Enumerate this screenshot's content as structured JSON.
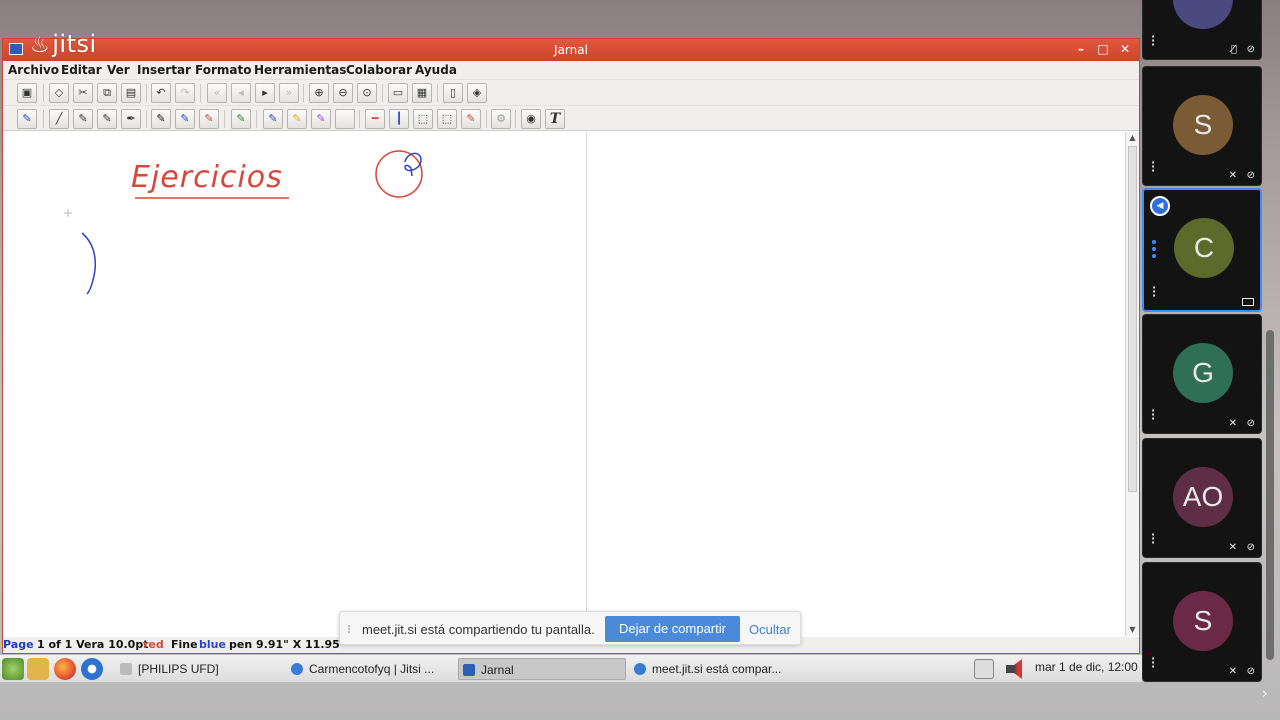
{
  "window": {
    "title": "Jarnal",
    "minimize_label": "–",
    "maximize_label": "□",
    "close_label": "✕"
  },
  "overlay_logo": {
    "text": "jitsi",
    "mark": "♨"
  },
  "menu": [
    "Archivo",
    "Editar",
    "Ver",
    "Insertar",
    "Formato",
    "Herramientas",
    "Colaborar",
    "Ayuda"
  ],
  "canvas": {
    "handwritten_title": "Ejercicios"
  },
  "status": {
    "page_prefix": "Page",
    "page_rest": "1 of 1 Vera 10.0pt",
    "color1": "red",
    "pen_word": "Fine",
    "color2": "blue",
    "size_text": "pen  9.91\" X 11.95\""
  },
  "share": {
    "message": "meet.jit.si está compartiendo tu pantalla.",
    "stop_button": "Dejar de compartir",
    "hide_link": "Ocultar"
  },
  "taskbar": {
    "tasks": [
      {
        "label": "[PHILIPS UFD]"
      },
      {
        "label": "Carmencotofyq | Jitsi ..."
      },
      {
        "label": "Jarnal"
      },
      {
        "label": "meet.jit.si está compar..."
      }
    ],
    "clock": "mar  1 de dic, 12:00"
  },
  "participants": [
    {
      "initials": "S",
      "color": "#7a5b36"
    },
    {
      "initials": "C",
      "color": "#5d6a2b"
    },
    {
      "initials": "G",
      "color": "#2f6e57"
    },
    {
      "initials": "AO",
      "color": "#5e2e45"
    },
    {
      "initials": "S",
      "color": "#6a2a45"
    }
  ],
  "colors": {
    "title_red": "#d9513a",
    "ink_red": "#d9473a",
    "ink_blue": "#2b44c9",
    "share_button": "#4a8ad9",
    "active_tile_border": "#3f8cff"
  }
}
